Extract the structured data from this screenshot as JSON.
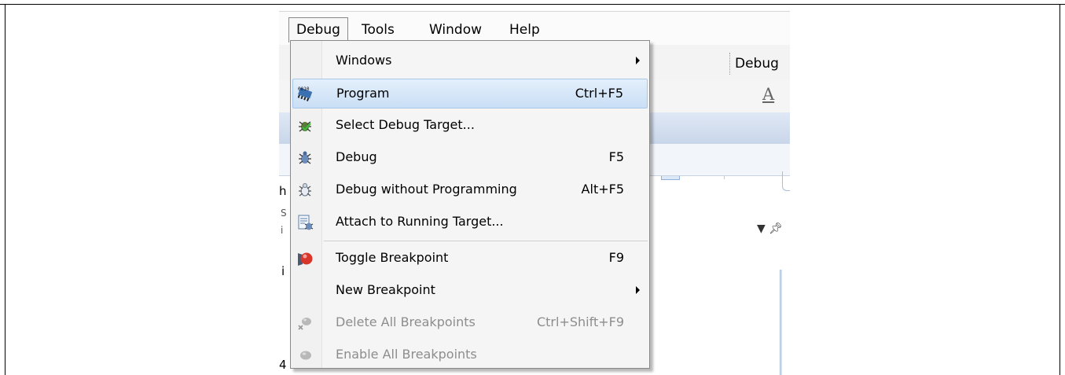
{
  "menubar": {
    "items": [
      {
        "label": "Debug",
        "active": true
      },
      {
        "label": "Tools",
        "active": false
      },
      {
        "label": "Window",
        "active": false
      },
      {
        "label": "Help",
        "active": false
      }
    ]
  },
  "toolbar": {
    "config_combo": "Debug"
  },
  "background_fragments": {
    "f1": "h",
    "f2": "S",
    "f3": "i",
    "f4": "4"
  },
  "debug_menu": {
    "items": [
      {
        "label": "Windows",
        "shortcut": "",
        "submenu": true,
        "icon": "none",
        "state": "normal"
      },
      {
        "label": "Program",
        "shortcut": "Ctrl+F5",
        "submenu": false,
        "icon": "program-chip-icon",
        "state": "highlighted"
      },
      {
        "label": "Select Debug Target...",
        "shortcut": "",
        "submenu": false,
        "icon": "select-target-bug-icon",
        "state": "normal"
      },
      {
        "label": "Debug",
        "shortcut": "F5",
        "submenu": false,
        "icon": "debug-bug-icon",
        "state": "normal"
      },
      {
        "label": "Debug without Programming",
        "shortcut": "Alt+F5",
        "submenu": false,
        "icon": "debug-no-program-icon",
        "state": "normal"
      },
      {
        "label": "Attach to Running Target...",
        "shortcut": "",
        "submenu": false,
        "icon": "attach-target-icon",
        "state": "normal"
      },
      {
        "label": "Toggle Breakpoint",
        "shortcut": "F9",
        "submenu": false,
        "icon": "breakpoint-icon",
        "state": "normal"
      },
      {
        "label": "New Breakpoint",
        "shortcut": "",
        "submenu": true,
        "icon": "none",
        "state": "normal"
      },
      {
        "label": "Delete All Breakpoints",
        "shortcut": "Ctrl+Shift+F9",
        "submenu": false,
        "icon": "delete-breakpoints-icon",
        "state": "disabled"
      },
      {
        "label": "Enable All Breakpoints",
        "shortcut": "",
        "submenu": false,
        "icon": "enable-breakpoints-icon",
        "state": "disabled"
      }
    ]
  },
  "colors": {
    "highlight": "#c9def5",
    "highlight_border": "#a8c8ea",
    "disabled_text": "#8d8d8d",
    "breakpoint_red": "#d9362b"
  }
}
